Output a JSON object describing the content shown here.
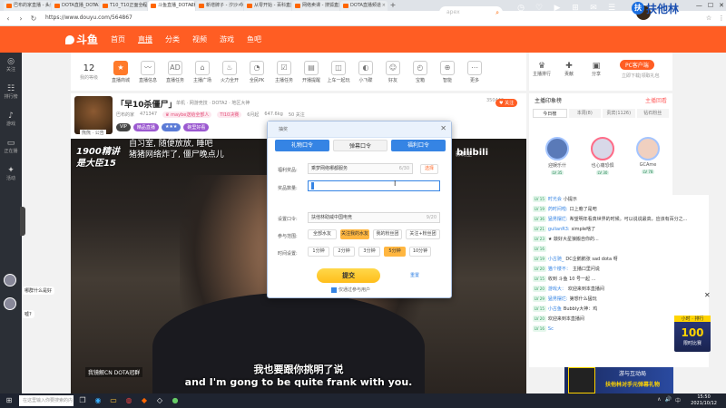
{
  "browser": {
    "tabs": [
      {
        "label": "巴布的家直播 - 头条直播",
        "active": false
      },
      {
        "label": "DOTA直播_DOTA2直播频道",
        "active": false
      },
      {
        "label": "T10_T10正面全程直播",
        "active": false
      },
      {
        "label": "斗鱼直播_DOTA2精彩 头条",
        "active": true
      },
      {
        "label": "新增牌子 - 汐沙 今日...",
        "active": false
      },
      {
        "label": "从零开始 - 百科直播 ...",
        "active": false
      },
      {
        "label": "网络卖课 - 搜狐直播",
        "active": false
      },
      {
        "label": "DOTA直播频道",
        "active": false
      }
    ],
    "new_tab": "+",
    "url": "https://www.douyu.com/564867",
    "brand": "扶他林",
    "brand_mark": "扶",
    "window_controls": [
      "—",
      "☐",
      "✕"
    ]
  },
  "header": {
    "logo": "斗鱼",
    "nav": [
      "首页",
      "直播",
      "分类",
      "视频",
      "游戏",
      "鱼吧"
    ],
    "search_placeholder": "apex",
    "icons": [
      {
        "glyph": "◷",
        "label": "历史"
      },
      {
        "glyph": "♡",
        "label": "关注"
      },
      {
        "glyph": "▶",
        "label": "开播"
      },
      {
        "glyph": "⊞",
        "label": "客户端"
      },
      {
        "glyph": "✉",
        "label": "消息"
      },
      {
        "glyph": "☰",
        "label": "操作中心"
      }
    ]
  },
  "left_sidebar": [
    {
      "glyph": "◎",
      "label": "关注"
    },
    {
      "glyph": "☷",
      "label": "排行榜"
    },
    {
      "glyph": "♪",
      "label": "游戏"
    },
    {
      "glyph": "▭",
      "label": "正在播"
    },
    {
      "glyph": "✦",
      "label": "活动"
    }
  ],
  "category_strip": {
    "level": "12",
    "level_label": "我的等级",
    "items": [
      {
        "glyph": "★",
        "label": "直播商城",
        "hot": true
      },
      {
        "glyph": "〰",
        "label": "直播信息",
        "hot": false
      },
      {
        "glyph": "AD",
        "label": "直播任务",
        "hot": false
      },
      {
        "glyph": "⌂",
        "label": "主播广场",
        "hot": false
      },
      {
        "glyph": "♨",
        "label": "火力全开",
        "hot": false
      },
      {
        "glyph": "◔",
        "label": "全民PK",
        "hot": false
      },
      {
        "glyph": "☑",
        "label": "主播任务",
        "hot": false
      },
      {
        "glyph": "▤",
        "label": "开播提醒",
        "hot": false
      },
      {
        "glyph": "◫",
        "label": "上车一起玩",
        "hot": false
      },
      {
        "glyph": "◐",
        "label": "小飞碟",
        "hot": false
      },
      {
        "glyph": "☺",
        "label": "好友",
        "hot": false
      },
      {
        "glyph": "◴",
        "label": "宝箱",
        "hot": false
      },
      {
        "glyph": "⊕",
        "label": "智能",
        "hot": false
      },
      {
        "glyph": "⋯",
        "label": "更多",
        "hot": false
      }
    ]
  },
  "right_strip": {
    "pc_badge": "PC客户端",
    "pc_sub": "立即下载|领取礼包",
    "icons": [
      {
        "glyph": "♛",
        "label": "主播排行"
      },
      {
        "glyph": "✚",
        "label": "贡献"
      },
      {
        "glyph": "▣",
        "label": "分享"
      }
    ]
  },
  "room": {
    "title": "「早10杀僵尸」",
    "category": "单机 · 网游竞技 · DOTA2 · 地区大神",
    "id_label": "巴布的家",
    "meta": [
      "471347",
      "♛ maybe送给全部人",
      "TI10决赛",
      "6月起",
      "647.6kg",
      "50 关注"
    ],
    "tags": [
      "VIP",
      "精品直播",
      "★★★",
      "碗里好看"
    ],
    "avatar_tag": "熊熊 · 公告",
    "viewers": "350446",
    "follow": "关注"
  },
  "video": {
    "hud_left": "1900精讲\n是大臣15",
    "hud_text": "自习室, 随便放放, 睡吧\n猪猪网络炸了, 僵尸晚点儿",
    "watermark": "bilibili",
    "studio": "影剧室",
    "team_banner": "我镜解CN DOTA冠群",
    "subtitle_cn": "我也要跟你挑明了说",
    "subtitle_en": "and I'm gong to be quite frank with you."
  },
  "dialog": {
    "title": "抽奖",
    "close": "✕",
    "tabs": [
      {
        "label": "礼物口令",
        "style": "blue"
      },
      {
        "label": "弹幕口令",
        "style": "plain"
      },
      {
        "label": "福利口令",
        "style": "blue"
      }
    ],
    "prize_label": "福利奖品:",
    "prize_value": "乘梦网络哪都服务",
    "prize_count": "6/30",
    "prize_btn": "选择",
    "qty_label": "奖品数量:",
    "qty_value": "",
    "code_label": "设置口令:",
    "code_value": "扶他林助威中国电竞",
    "code_count": "9/20",
    "scope_label": "参与范围:",
    "scope_options": [
      "全部水友",
      "关注我的水友",
      "我的粉丝团",
      "关注+粉丝团"
    ],
    "scope_selected": 1,
    "time_label": "时间设置:",
    "time_options": [
      "1分钟",
      "2分钟",
      "3分钟",
      "5分钟",
      "10分钟"
    ],
    "time_selected": 3,
    "submit": "提交",
    "reset": "重置",
    "agree": "仅通过参与用户"
  },
  "rank_panel": {
    "head_left": "主播印象榜",
    "head_right": "主播回看",
    "tabs": [
      "今日榜",
      "本周(8)",
      "贵宾(1126)",
      "钻石粉丝"
    ],
    "top3": [
      {
        "name": "迎娱乐什",
        "lv": "LV 35"
      },
      {
        "name": "也心痛恐惧",
        "lv": "LV 30"
      },
      {
        "name": "GCAme",
        "lv": "LV 78"
      }
    ]
  },
  "chat": [
    {
      "lv": "LV 15",
      "name": "时光会",
      "text": "小提示"
    },
    {
      "lv": "LV 19",
      "name": "药时间啦:",
      "text": "口上瘾了是吧"
    },
    {
      "lv": "LV 36",
      "name": "猛男摆烂:",
      "text": "希望明年看真世界的时候。可以说说最高，应该有百分之..."
    },
    {
      "lv": "LV 21",
      "name": "gulianR3:",
      "text": "simple啥了"
    },
    {
      "lv": "LV 23",
      "name": "",
      "text": "★ 敲好大星狼搬自你的..."
    },
    {
      "lv": "LV 16",
      "name": "",
      "text": ""
    },
    {
      "lv": "LV 19",
      "name": "小古驰_",
      "text": "DC企鹅鹅张   sad dota 呀"
    },
    {
      "lv": "LV 20",
      "name": "猫个楼不：",
      "text": "主播口里问说"
    },
    {
      "lv": "LV 15",
      "name": "",
      "text": "收到 斗鱼 10 号一起 …"
    },
    {
      "lv": "LV 20",
      "name": "游戏大：",
      "text": "欢迎来到本直播间"
    },
    {
      "lv": "LV 29",
      "name": "猛男摆烂:",
      "text": "第想什么猛玩"
    },
    {
      "lv": "LV 15",
      "name": "小古鱼",
      "text": "Bubbly大神：鸡"
    },
    {
      "lv": "LV 20",
      "name": "",
      "text": "欢迎来到本直播间"
    },
    {
      "lv": "LV 16",
      "name": "Sc",
      "text": ""
    }
  ],
  "left_bubbles": [
    {
      "text": "哪群什么是好"
    },
    {
      "text": "嘘?"
    }
  ],
  "rank_promo": {
    "top": "小时 · 排行",
    "big": "100",
    "sub": "限时比赛"
  },
  "bottom_promo": {
    "line1": "游与互动局",
    "line2": "扶他林对手元弹幕礼物"
  },
  "taskbar": {
    "search": "在这里输入你要搜索的内容",
    "time": "15:50",
    "date": "2021/10/12",
    "tray": [
      "∧",
      "🔊",
      "中"
    ]
  }
}
